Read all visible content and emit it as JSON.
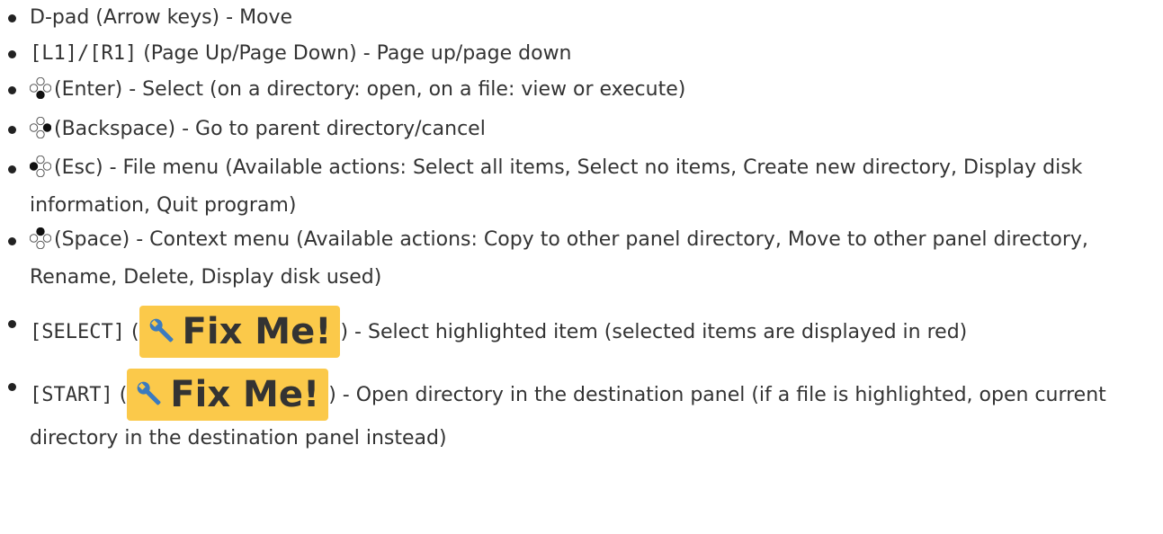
{
  "items": [
    {
      "key": "",
      "text": "D-pad (Arrow keys) - Move"
    },
    {
      "key": "[L1]/[R1]",
      "text": " (Page Up/Page Down) - Page up/page down"
    },
    {
      "icon": "bottom-button-icon",
      "text": "(Enter) - Select (on a directory: open, on a file: view or execute)"
    },
    {
      "icon": "right-button-icon",
      "text": "(Backspace) - Go to parent directory/cancel"
    },
    {
      "icon": "left-button-icon",
      "text": "(Esc) - File menu (Available actions: Select all items, Select no items, Create new directory, Display disk information, Quit program)"
    },
    {
      "icon": "top-button-icon",
      "text": "(Space) - Context menu (Available actions: Copy to other panel directory, Move to other panel directory, Rename, Delete, Display disk used)"
    },
    {
      "key": "[SELECT]",
      "pre": " (",
      "fixme": "Fix Me!",
      "text": ") - Select highlighted item (selected items are displayed in red)"
    },
    {
      "key": "[START]",
      "pre": " (",
      "fixme": "Fix Me!",
      "text": ") - Open directory in the destination panel (if a file is highlighted, open current directory in the destination panel instead)"
    }
  ],
  "colors": {
    "fixme_bg": "#fbc94a",
    "wrench": "#3b7bbf",
    "text": "#333333"
  }
}
